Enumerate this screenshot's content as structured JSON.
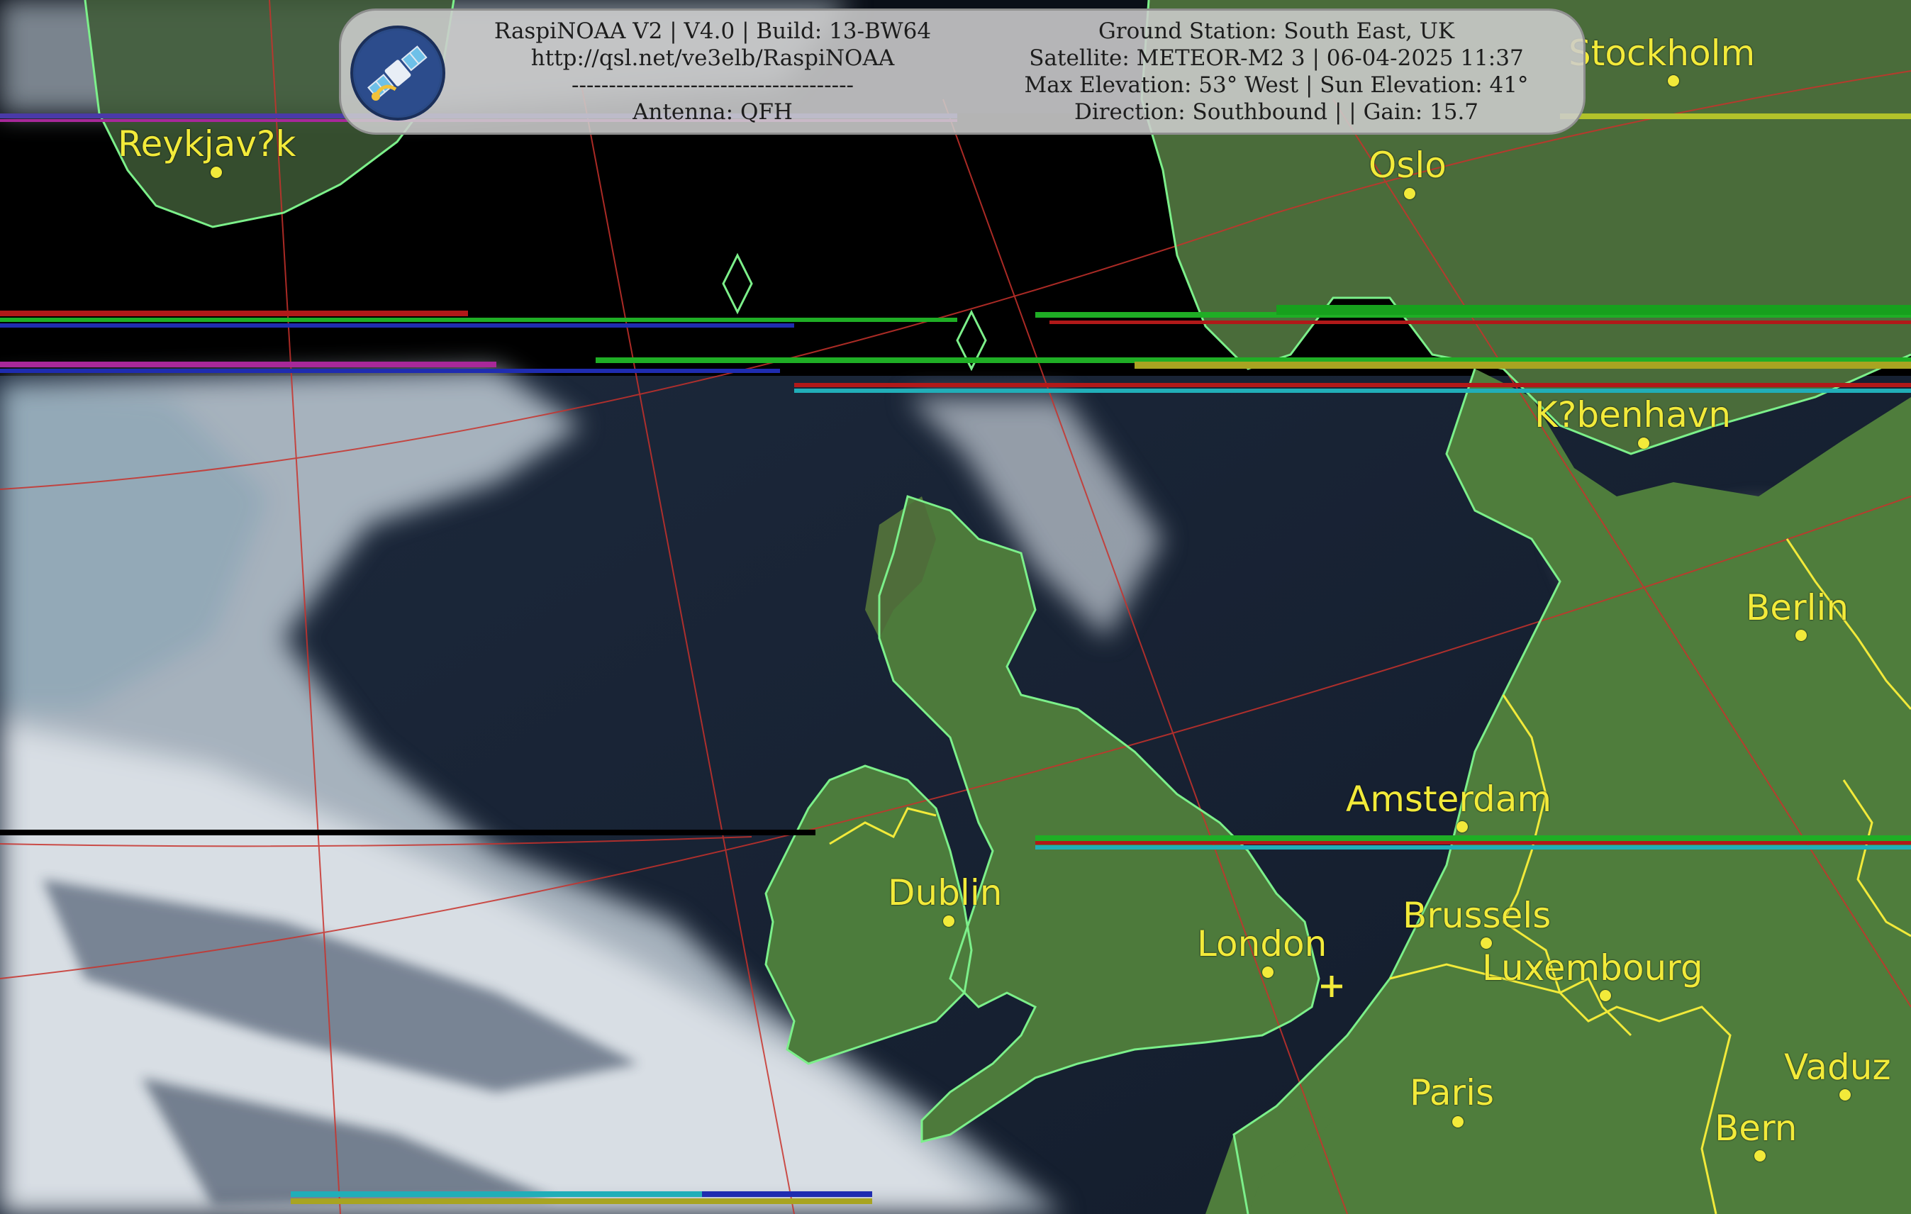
{
  "header": {
    "left_lines": [
      "RaspiNOAA V2 | V4.0 | Build: 13-BW64",
      "http://qsl.net/ve3elb/RaspiNOAA",
      "--------------------------------------",
      "Antenna: QFH"
    ],
    "right_lines": [
      "Ground Station: South East, UK",
      "Satellite: METEOR-M2 3 | 06-04-2025 11:37",
      "Max Elevation: 53° West | Sun Elevation: 41°",
      "Direction: Southbound | | Gain: 15.7"
    ]
  },
  "cities": [
    {
      "name": "Reykjav?k"
    },
    {
      "name": "Stockholm"
    },
    {
      "name": "Oslo"
    },
    {
      "name": "K?benhavn"
    },
    {
      "name": "Berlin"
    },
    {
      "name": "Amsterdam"
    },
    {
      "name": "Dublin"
    },
    {
      "name": "London"
    },
    {
      "name": "Brussels"
    },
    {
      "name": "Luxembourg"
    },
    {
      "name": "Paris"
    },
    {
      "name": "Vaduz"
    },
    {
      "name": "Bern"
    }
  ],
  "colors": {
    "coastline": "#7cf08a",
    "borders": "#f2ea3a",
    "graticule": "#c8322c",
    "city_label": "#f2ea3a",
    "sea": "#1a2638",
    "land": "#4c7a3a",
    "cloud": "#c9d3db"
  },
  "icons": {
    "logo": "satellite-icon",
    "station": "plus-marker-icon"
  }
}
